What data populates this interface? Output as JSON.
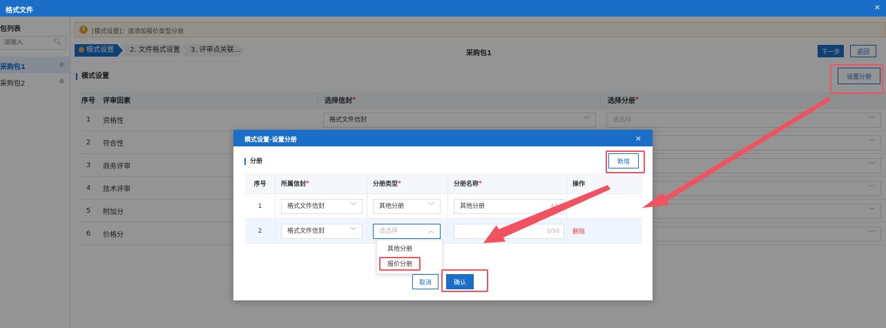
{
  "window": {
    "title": "格式文件",
    "close": "×"
  },
  "sidebar": {
    "title": "包列表",
    "search_placeholder": "请输入",
    "items": [
      {
        "label": "采购包1"
      },
      {
        "label": "采购包2"
      }
    ]
  },
  "notice": {
    "text": "[模式设置]：请添加报价类型分册"
  },
  "steps": [
    {
      "label": "模式设置"
    },
    {
      "label": "2. 文件格式设置"
    },
    {
      "label": "3. 评审点关联..."
    }
  ],
  "header": {
    "package_name": "采购包1",
    "next_label": "下一步",
    "back_label": "返回"
  },
  "section": {
    "title": "模式设置",
    "set_fen_label": "设置分册"
  },
  "table": {
    "headers": {
      "no": "序号",
      "factor": "评审因素",
      "envelope": "选择信封",
      "fen": "选择分册",
      "required": "*"
    },
    "rows": [
      {
        "no": "1",
        "factor": "资格性",
        "envelope": "格式文件信封",
        "fen": "请选择"
      },
      {
        "no": "2",
        "factor": "符合性"
      },
      {
        "no": "3",
        "factor": "商务评审"
      },
      {
        "no": "4",
        "factor": "技术评审"
      },
      {
        "no": "5",
        "factor": "附加分"
      },
      {
        "no": "6",
        "factor": "价格分"
      }
    ]
  },
  "modal": {
    "title": "模式设置-设置分册",
    "close": "×",
    "section_title": "分册",
    "add_label": "新增",
    "headers": {
      "no": "序号",
      "envelope": "所属信封",
      "type": "分册类型",
      "name": "分册名称",
      "op": "操作",
      "required": "*"
    },
    "rows": [
      {
        "no": "1",
        "envelope": "格式文件信封",
        "type": "其他分册",
        "name": "其他分册",
        "count": "4/5"
      },
      {
        "no": "2",
        "envelope": "格式文件信封",
        "type_placeholder": "请选择",
        "name": "",
        "count": "0/50",
        "delete_label": "删除"
      }
    ],
    "dropdown": [
      "其他分册",
      "报价分册"
    ],
    "cancel_label": "取消",
    "ok_label": "确认"
  },
  "colors": {
    "primary": "#1a6ec7",
    "highlight": "#f0525f",
    "danger": "#e53935",
    "warning": "#e6a23c"
  },
  "icons": [
    "close-icon",
    "search-icon",
    "warning-icon",
    "chevron-down-icon",
    "chevron-up-icon",
    "status-dot-icon",
    "arrow-annotation"
  ]
}
